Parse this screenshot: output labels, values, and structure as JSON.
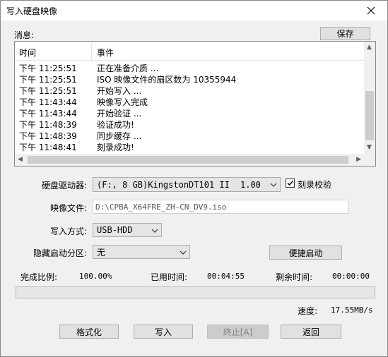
{
  "window": {
    "title": "写入硬盘映像"
  },
  "messages": {
    "label": "消息:",
    "save_button": "保存",
    "columns": {
      "time": "时间",
      "event": "事件"
    },
    "rows": [
      {
        "time": "下午 11:25:51",
        "event": "正在准备介质 ..."
      },
      {
        "time": "下午 11:25:51",
        "event": "ISO 映像文件的扇区数为 10355944"
      },
      {
        "time": "下午 11:25:51",
        "event": "开始写入 ..."
      },
      {
        "time": "下午 11:43:44",
        "event": "映像写入完成"
      },
      {
        "time": "下午 11:43:44",
        "event": "开始验证 ..."
      },
      {
        "time": "下午 11:48:39",
        "event": "验证成功!"
      },
      {
        "time": "下午 11:48:39",
        "event": "同步缓存 ..."
      },
      {
        "time": "下午 11:48:41",
        "event": "刻录成功!"
      }
    ]
  },
  "form": {
    "drive_label": "硬盘驱动器:",
    "drive_value": "(F:, 8 GB)KingstonDT101 II",
    "drive_version": "1.00",
    "verify_label": "刻录校验",
    "verify_checked": true,
    "image_label": "映像文件:",
    "image_value": "D:\\CPBA_X64FRE_ZH-CN_DV9.iso",
    "write_mode_label": "写入方式:",
    "write_mode_value": "USB-HDD",
    "hidden_partition_label": "隐藏启动分区:",
    "hidden_partition_value": "无",
    "quick_boot_button": "便捷启动"
  },
  "status": {
    "completion_label": "完成比例:",
    "completion_value": "100.00%",
    "elapsed_label": "已用时间:",
    "elapsed_value": "00:04:55",
    "remaining_label": "剩余时间:",
    "remaining_value": "00:00:00",
    "progress_fraction": 1.0,
    "speed_label": "速度:",
    "speed_value": "17.55MB/s"
  },
  "buttons": {
    "format": "格式化",
    "write": "写入",
    "stop": "终止[A]",
    "back": "返回"
  }
}
